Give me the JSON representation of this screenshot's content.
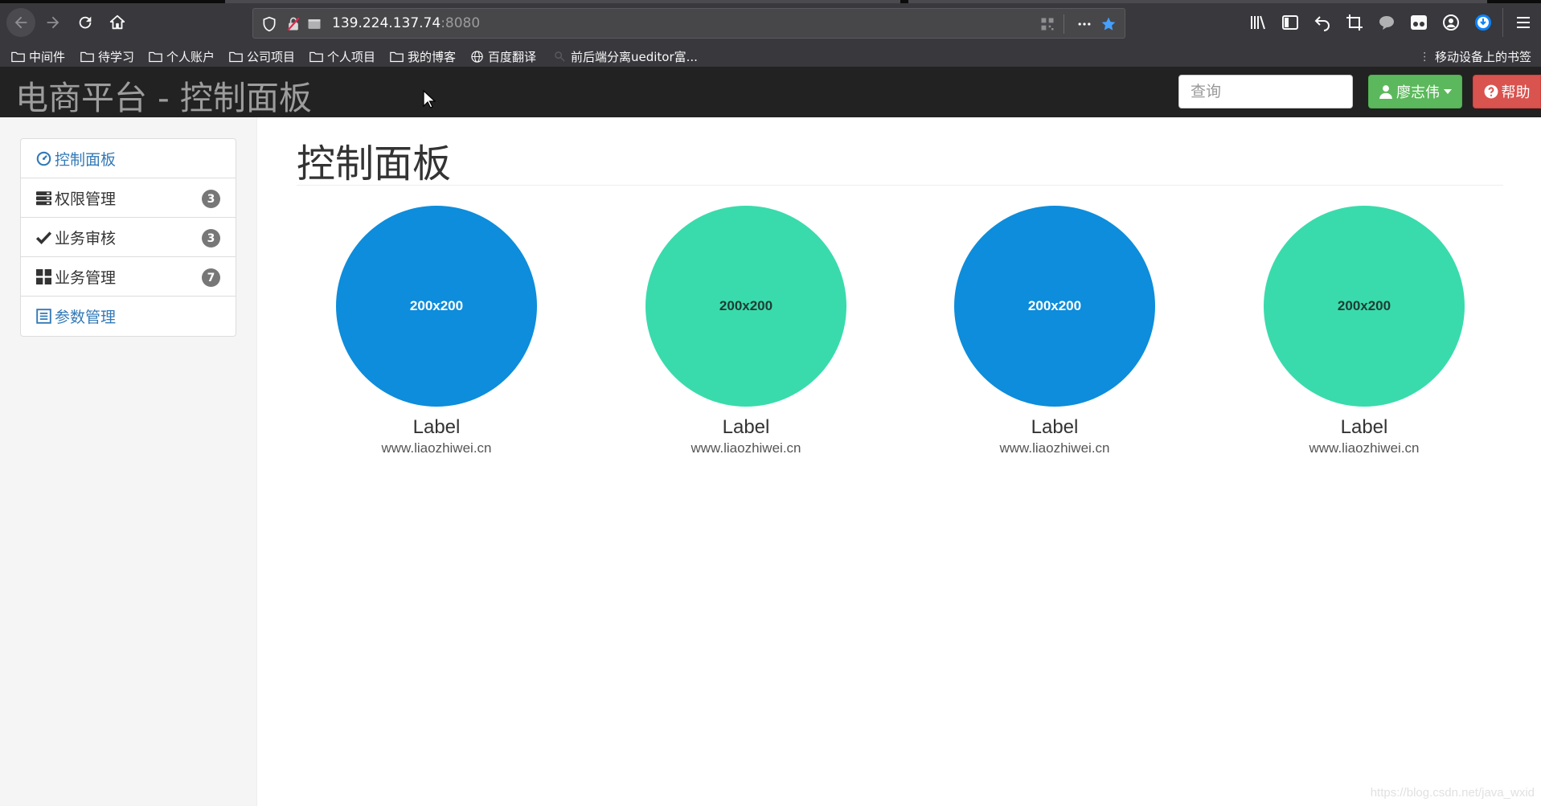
{
  "browser": {
    "url_host": "139.224.137.74",
    "url_port": ":8080",
    "bookmarks": [
      {
        "label": "中间件",
        "icon": "folder-icon"
      },
      {
        "label": "待学习",
        "icon": "folder-icon"
      },
      {
        "label": "个人账户",
        "icon": "folder-icon"
      },
      {
        "label": "公司项目",
        "icon": "folder-icon"
      },
      {
        "label": "个人项目",
        "icon": "folder-icon"
      },
      {
        "label": "我的博客",
        "icon": "folder-icon"
      },
      {
        "label": "百度翻译",
        "icon": "globe-icon"
      },
      {
        "label": "前后端分离ueditor富...",
        "icon": "page-icon"
      }
    ],
    "mobile_bookmarks": "移动设备上的书签"
  },
  "navbar": {
    "brand": "电商平台 - 控制面板",
    "search_placeholder": "查询",
    "user_button": "廖志伟",
    "help_button": "帮助",
    "colors": {
      "background": "#222222",
      "success": "#5cb85c",
      "danger": "#d9534f"
    }
  },
  "sidebar": {
    "items": [
      {
        "label": "控制面板",
        "icon": "dashboard-icon",
        "active": true
      },
      {
        "label": "权限管理",
        "icon": "tasks-icon",
        "badge": "3"
      },
      {
        "label": "业务审核",
        "icon": "checkmark-icon",
        "badge": "3"
      },
      {
        "label": "业务管理",
        "icon": "grid-icon",
        "badge": "7"
      },
      {
        "label": "参数管理",
        "icon": "list-icon",
        "active": true
      }
    ]
  },
  "main": {
    "title": "控制面板",
    "tiles": [
      {
        "placeholder": "200x200",
        "label": "Label",
        "sub": "www.liaozhiwei.cn",
        "color": "#0d8ddb",
        "text_color": "#ffffff"
      },
      {
        "placeholder": "200x200",
        "label": "Label",
        "sub": "www.liaozhiwei.cn",
        "color": "#39dbac",
        "text_color": "#1e3d33"
      },
      {
        "placeholder": "200x200",
        "label": "Label",
        "sub": "www.liaozhiwei.cn",
        "color": "#0d8ddb",
        "text_color": "#ffffff"
      },
      {
        "placeholder": "200x200",
        "label": "Label",
        "sub": "www.liaozhiwei.cn",
        "color": "#39dbac",
        "text_color": "#1e3d33"
      }
    ]
  },
  "watermark": "https://blog.csdn.net/java_wxid"
}
